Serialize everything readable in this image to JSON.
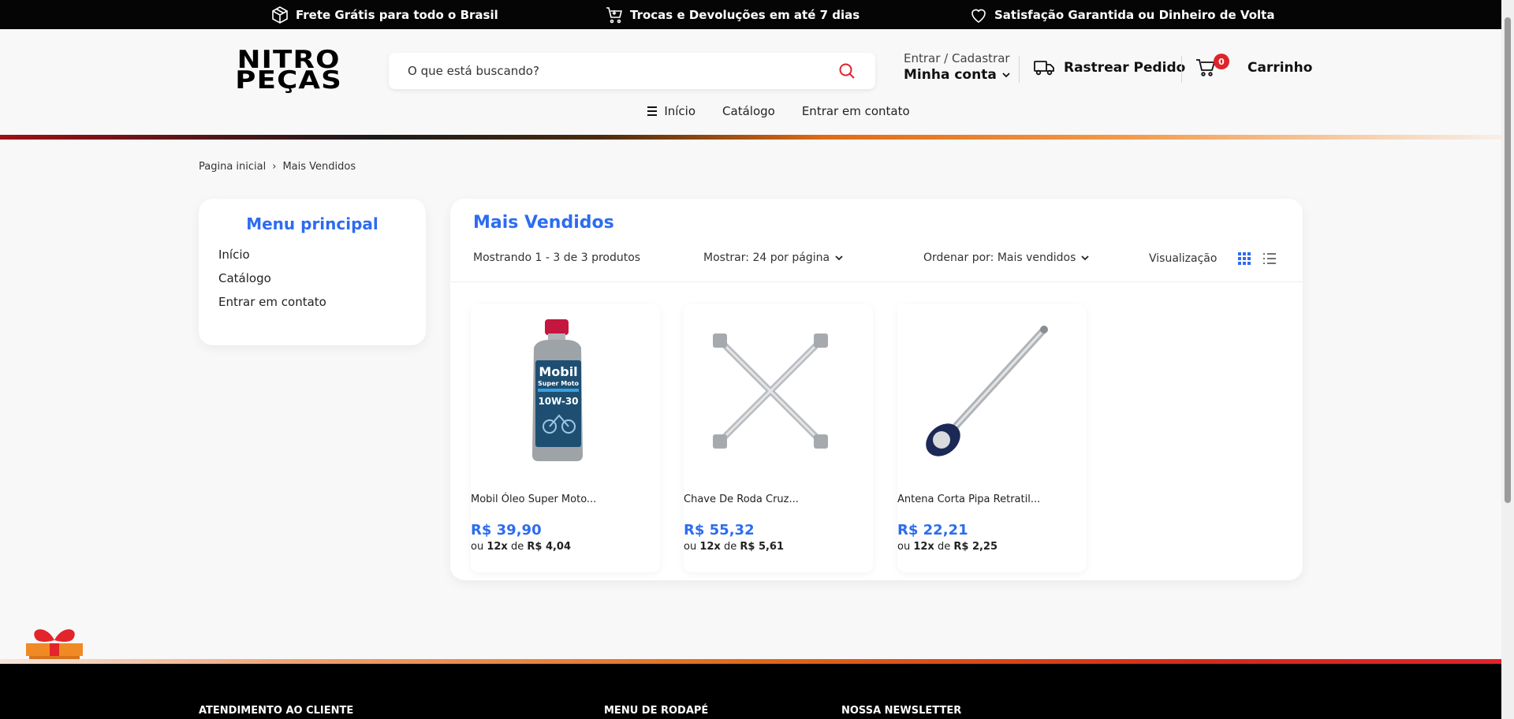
{
  "topbar": {
    "items": [
      {
        "icon": "box-icon",
        "label": "Frete Grátis para todo o Brasil"
      },
      {
        "icon": "cart-return-icon",
        "label": "Trocas e Devoluções em até 7 dias"
      },
      {
        "icon": "heart-icon",
        "label": "Satisfação Garantida ou Dinheiro de Volta"
      }
    ]
  },
  "header": {
    "logo_line1": "NITRO",
    "logo_line2": "PEÇAS",
    "search_placeholder": "O que está buscando?",
    "account_small": "Entrar / Cadastrar",
    "account_big": "Minha conta",
    "track_label": "Rastrear Pedido",
    "cart_count": "0",
    "cart_label": "Carrinho"
  },
  "nav": {
    "items": [
      "Início",
      "Catálogo",
      "Entrar em contato"
    ]
  },
  "breadcrumb": {
    "home": "Pagina inicial",
    "sep": "›",
    "current": "Mais Vendidos"
  },
  "sidebar": {
    "title": "Menu principal",
    "links": [
      "Início",
      "Catálogo",
      "Entrar em contato"
    ]
  },
  "main": {
    "title": "Mais Vendidos",
    "showing": "Mostrando 1 - 3 de 3 produtos",
    "per_page": "Mostrar: 24 por página",
    "sort": "Ordenar por: Mais vendidos",
    "view_label": "Visualização"
  },
  "products": [
    {
      "name": "Mobil Óleo Super Moto...",
      "price": "R$ 39,90",
      "inst_prefix": "ou",
      "inst_count": "12x",
      "inst_mid": "de",
      "inst_value": "R$ 4,04",
      "img_label_1": "Mobil",
      "img_label_2": "Super Moto",
      "img_label_3": "10W-30"
    },
    {
      "name": "Chave De Roda Cruz...",
      "price": "R$ 55,32",
      "inst_prefix": "ou",
      "inst_count": "12x",
      "inst_mid": "de",
      "inst_value": "R$ 5,61"
    },
    {
      "name": "Antena Corta Pipa Retratil...",
      "price": "R$ 22,21",
      "inst_prefix": "ou",
      "inst_count": "12x",
      "inst_mid": "de",
      "inst_value": "R$ 2,25"
    }
  ],
  "footer": {
    "col1": "ATENDIMENTO AO CLIENTE",
    "col2": "MENU DE RODAPÉ",
    "col3": "NOSSA NEWSLETTER"
  },
  "colors": {
    "accent_blue": "#2d6cf0",
    "accent_red": "#e0232b",
    "topbar_bg": "#050505"
  }
}
